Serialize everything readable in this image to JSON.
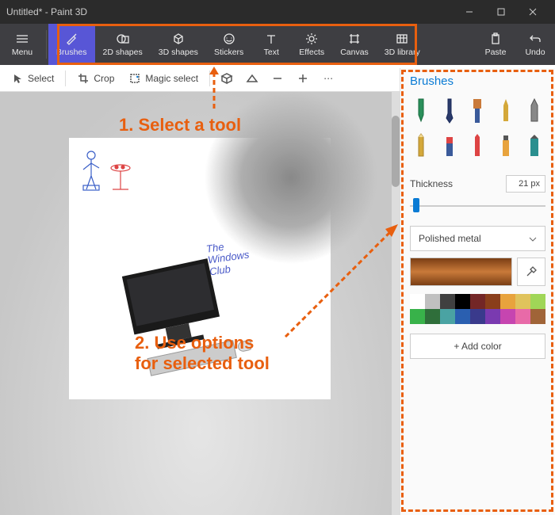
{
  "window": {
    "title": "Untitled* - Paint 3D"
  },
  "ribbon": {
    "menu": "Menu",
    "brushes": "Brushes",
    "shapes2d": "2D shapes",
    "shapes3d": "3D shapes",
    "stickers": "Stickers",
    "text": "Text",
    "effects": "Effects",
    "canvas": "Canvas",
    "library3d": "3D library",
    "paste": "Paste",
    "undo": "Undo"
  },
  "toolbar": {
    "select": "Select",
    "crop": "Crop",
    "magic": "Magic select"
  },
  "panel": {
    "title": "Brushes",
    "thickness_label": "Thickness",
    "thickness_value": "21 px",
    "material": "Polished metal",
    "add_color": "+  Add color"
  },
  "canvas_text": {
    "line1": "The",
    "line2": "Windows",
    "line3": "Club"
  },
  "palette": [
    "#ffffff",
    "#c0c0c0",
    "#404040",
    "#000000",
    "#732626",
    "#8a3e1b",
    "#e8a33d",
    "#e0c35c",
    "#a0d657",
    "#38b24a",
    "#2f6e3a",
    "#4aa3a3",
    "#2a5fb0",
    "#3a3a8c",
    "#7a3ab0",
    "#c645b0",
    "#e86aa8",
    "#a06438"
  ],
  "annotations": {
    "step1": "1. Select a tool",
    "step2": "2. Use options\nfor selected tool"
  }
}
